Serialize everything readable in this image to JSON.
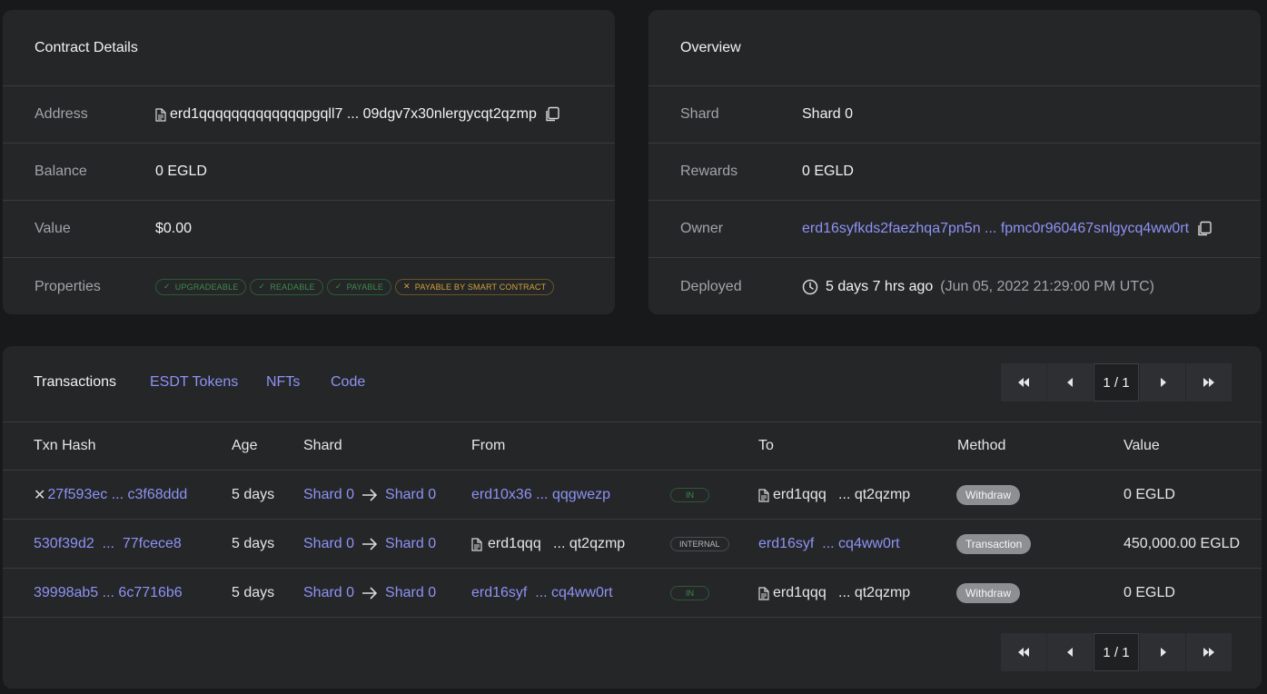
{
  "contract": {
    "title": "Contract Details",
    "address_label": "Address",
    "address": "erd1qqqqqqqqqqqqqpgqll7 ... 09dgv7x30nlergycqt2qzmp",
    "balance_label": "Balance",
    "balance": "0 EGLD",
    "value_label": "Value",
    "value": "$0.00",
    "properties_label": "Properties",
    "properties": [
      {
        "label": "UPGRADEABLE",
        "mark": "✓",
        "status": "ok"
      },
      {
        "label": "READABLE",
        "mark": "✓",
        "status": "ok"
      },
      {
        "label": "PAYABLE",
        "mark": "✓",
        "status": "ok"
      },
      {
        "label": "PAYABLE BY SMART CONTRACT",
        "mark": "✕",
        "status": "warn"
      }
    ]
  },
  "overview": {
    "title": "Overview",
    "shard_label": "Shard",
    "shard": "Shard 0",
    "rewards_label": "Rewards",
    "rewards": "0 EGLD",
    "owner_label": "Owner",
    "owner": "erd16syfkds2faezhqa7pn5n ... fpmc0r960467snlgycq4ww0rt",
    "deployed_label": "Deployed",
    "deployed_age": "5 days 7 hrs ago",
    "deployed_date": "(Jun 05, 2022 21:29:00 PM UTC)"
  },
  "tabs": [
    {
      "label": "Transactions",
      "active": true
    },
    {
      "label": "ESDT Tokens",
      "active": false
    },
    {
      "label": "NFTs",
      "active": false
    },
    {
      "label": "Code",
      "active": false
    }
  ],
  "pagination": {
    "page": "1 / 1"
  },
  "columns": [
    "Txn Hash",
    "Age",
    "Shard",
    "From",
    "To",
    "Method",
    "Value"
  ],
  "transactions": [
    {
      "failed": true,
      "fail_mark": "✕",
      "hash": "27f593ec ... c3f68ddd",
      "age": "5 days",
      "shard_from": "Shard 0",
      "shard_to": "Shard 0",
      "from": "erd10x36 ... qqgwezp",
      "from_contract": false,
      "direction": "IN",
      "to": "erd1qqq   ... qt2qzmp",
      "to_contract": true,
      "method": "Withdraw",
      "value": "0 EGLD"
    },
    {
      "failed": false,
      "fail_mark": "",
      "hash": "530f39d2  ...  77fcece8",
      "age": "5 days",
      "shard_from": "Shard 0",
      "shard_to": "Shard 0",
      "from": "erd1qqq   ... qt2qzmp",
      "from_contract": true,
      "direction": "INTERNAL",
      "to": "erd16syf  ... cq4ww0rt",
      "to_contract": false,
      "method": "Transaction",
      "value": "450,000.00 EGLD"
    },
    {
      "failed": false,
      "fail_mark": "",
      "hash": "39998ab5 ... 6c7716b6",
      "age": "5 days",
      "shard_from": "Shard 0",
      "shard_to": "Shard 0",
      "from": "erd16syf  ... cq4ww0rt",
      "from_contract": false,
      "direction": "IN",
      "to": "erd1qqq   ... qt2qzmp",
      "to_contract": true,
      "method": "Withdraw",
      "value": "0 EGLD"
    }
  ],
  "colors": {
    "background": "#18191b",
    "card": "#252628",
    "link": "#8d93f4",
    "success": "#3c8b4a",
    "warning": "#d4a13b"
  }
}
